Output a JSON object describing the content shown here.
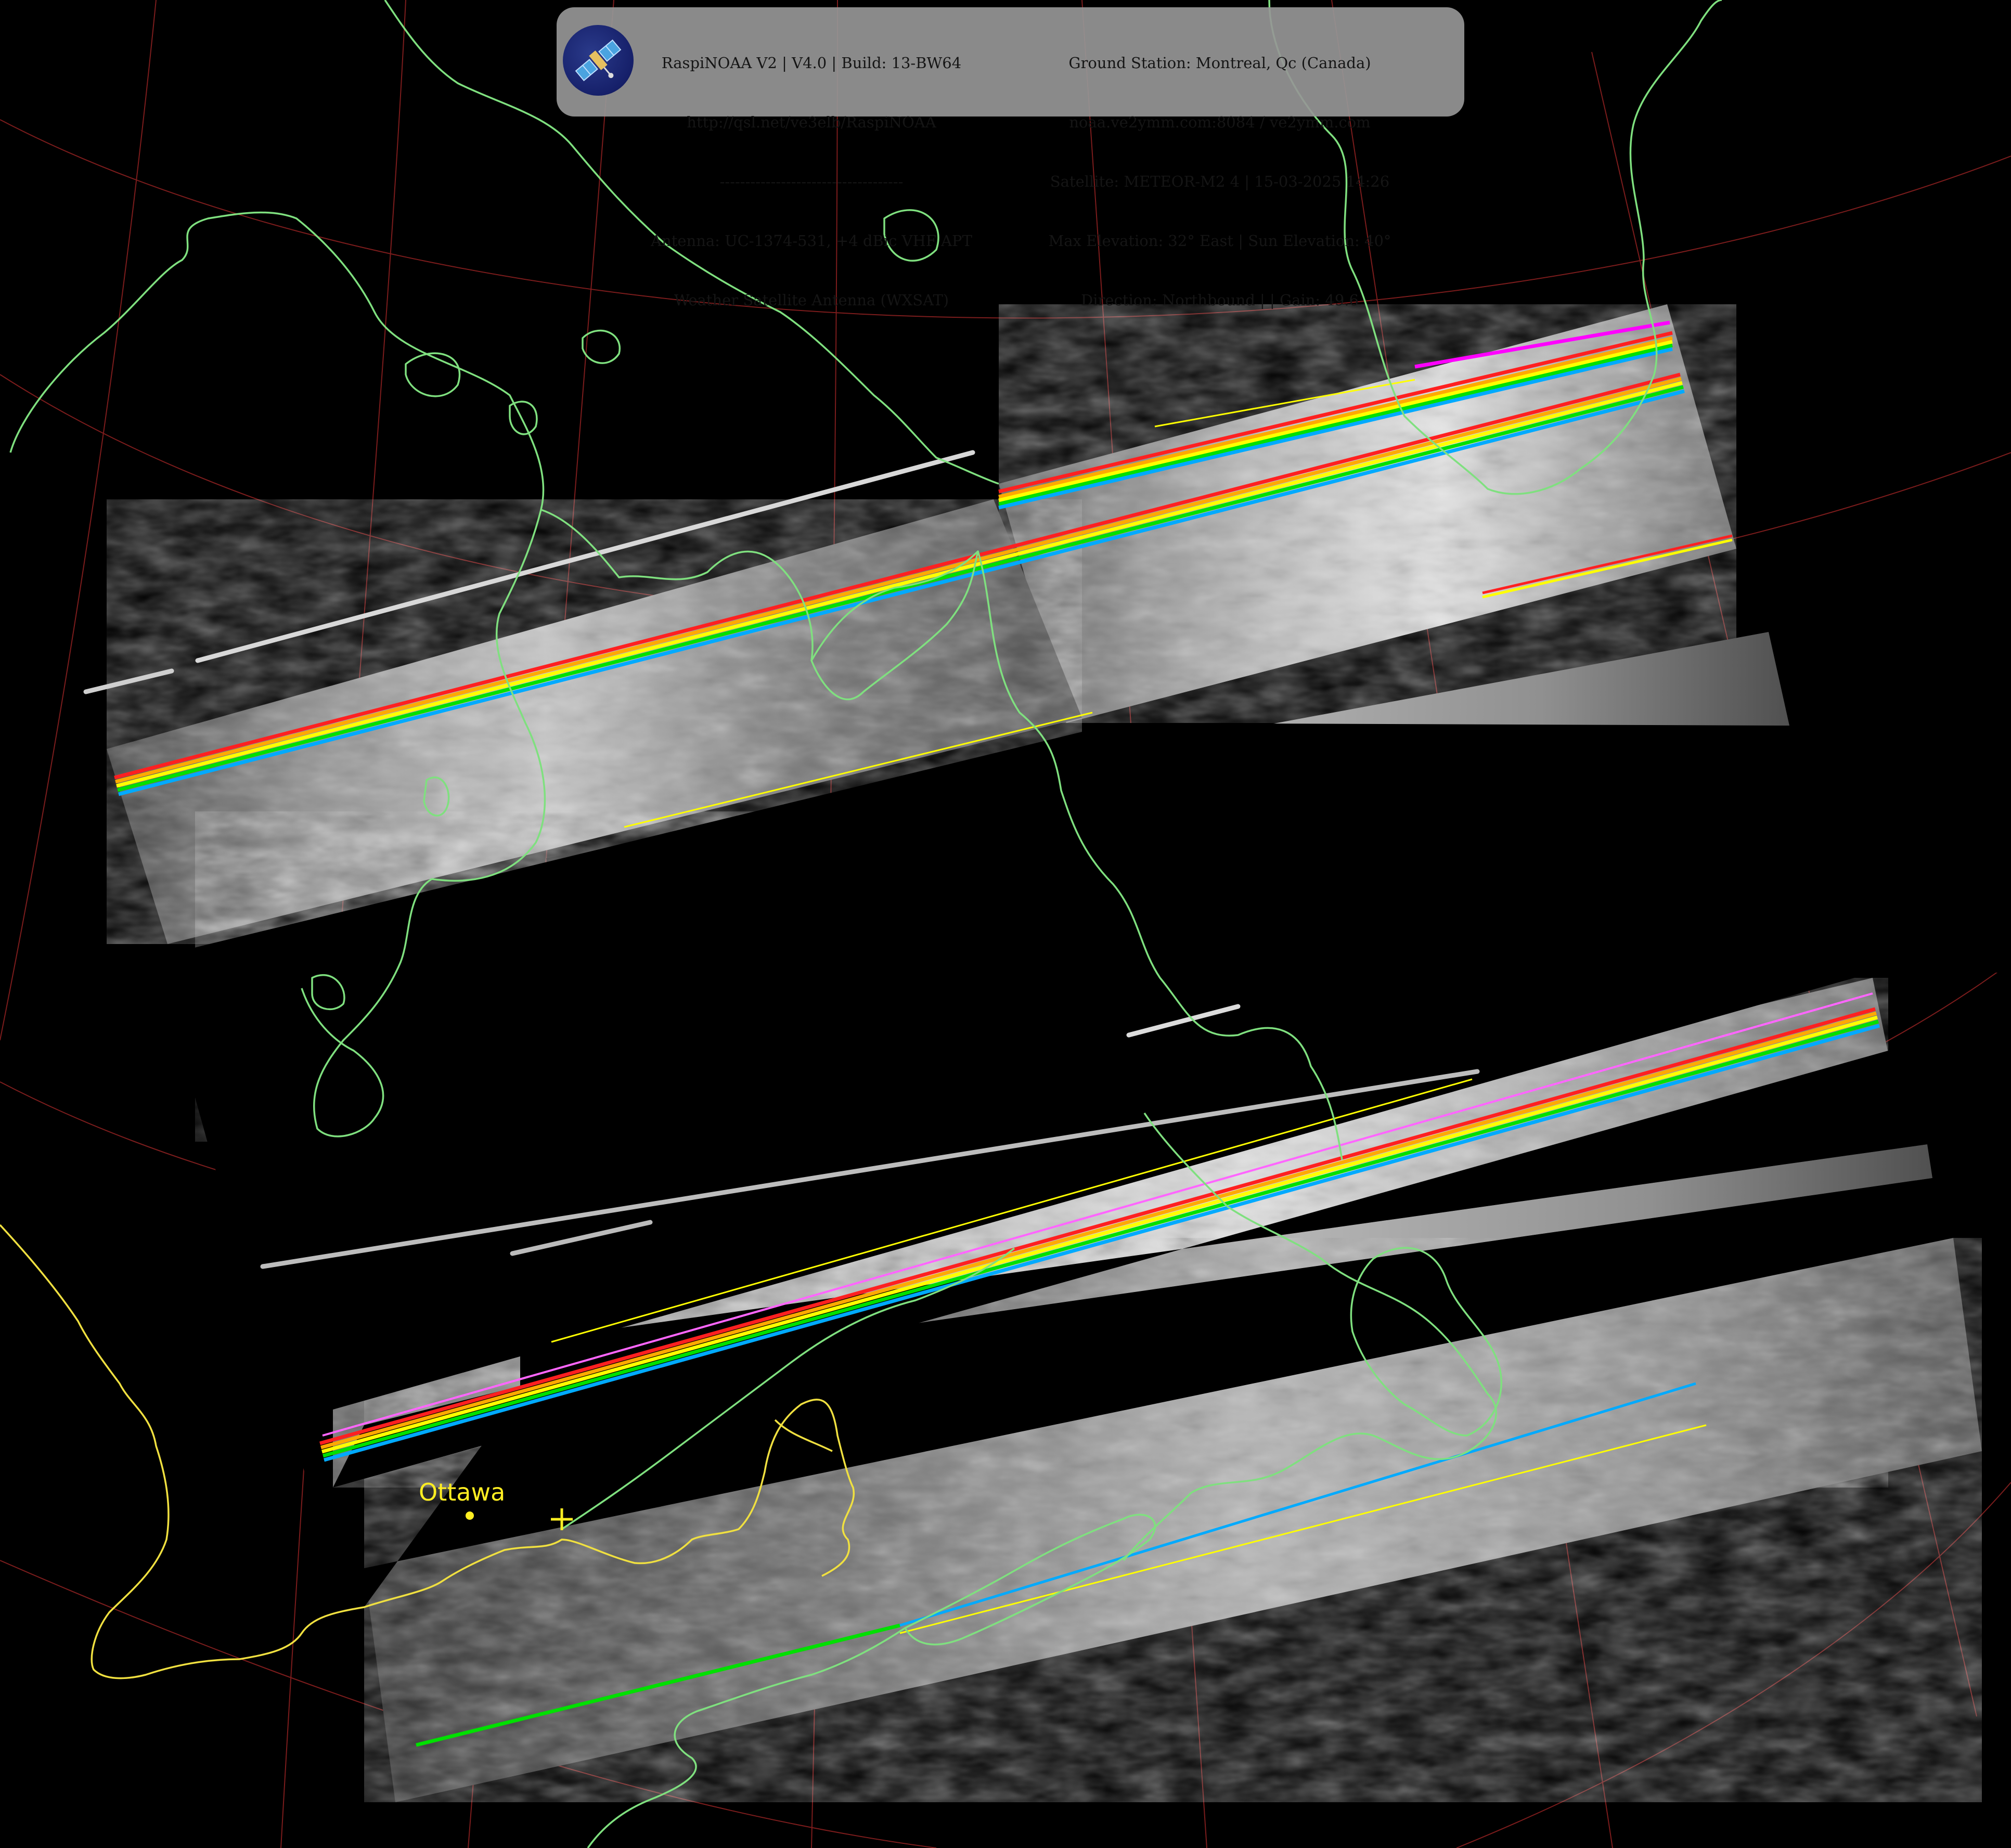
{
  "header": {
    "left_lines": [
      "RaspiNOAA V2 | V4.0 | Build: 13-BW64",
      "http://qsl.net/ve3elb/RaspiNOAA",
      "------------------------------------",
      "Antenna: UC-1374-531, +4 dBic VHF APT",
      "Weather Satellite Antenna (WXSAT)"
    ],
    "right_lines": [
      "Ground Station: Montreal, Qc (Canada)",
      "noaa.ve2ymm.com:8084 / ve2ymm.com",
      "Satellite: METEOR-M2 4 | 15-03-2025 14:26",
      "Max Elevation: 32° East | Sun Elevation: 40°",
      "Direction: Northbound | | Gain: 49.6"
    ]
  },
  "map": {
    "city": "Ottawa",
    "colors": {
      "background": "#000000",
      "coastline": "#7fe07f",
      "border": "#f0e040",
      "graticule": "#8a2020",
      "marker": "#ffee22"
    },
    "logo_icon": "satellite-icon"
  }
}
